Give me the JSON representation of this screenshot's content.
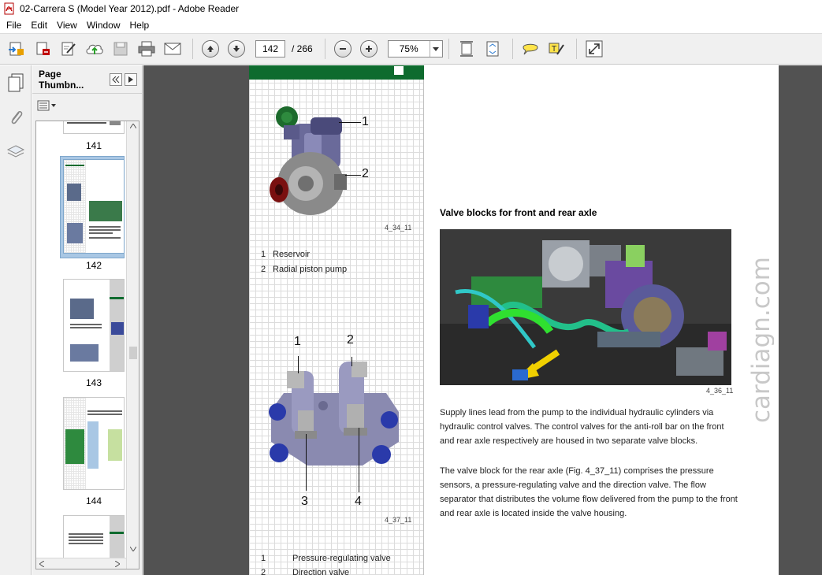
{
  "window": {
    "title": "02-Carrera S (Model Year 2012).pdf - Adobe Reader"
  },
  "menu": [
    "File",
    "Edit",
    "View",
    "Window",
    "Help"
  ],
  "toolbar": {
    "page_current": "142",
    "page_total": "/ 266",
    "zoom": "75%"
  },
  "thumbnails": {
    "header": "Page Thumbn...",
    "pages": [
      {
        "label": "141",
        "selected": false
      },
      {
        "label": "142",
        "selected": true
      },
      {
        "label": "143",
        "selected": false
      },
      {
        "label": "144",
        "selected": false
      }
    ]
  },
  "document": {
    "figure1": {
      "caption": "4_34_11",
      "callouts": [
        "1",
        "2"
      ],
      "legend": [
        {
          "num": "1",
          "text": "Reservoir"
        },
        {
          "num": "2",
          "text": "Radial piston pump"
        }
      ]
    },
    "figure2": {
      "caption": "4_37_11",
      "callouts": [
        "1",
        "2",
        "3",
        "4"
      ],
      "legend": [
        {
          "num": "1",
          "text": "Pressure-regulating valve"
        },
        {
          "num": "2",
          "text": "Direction valve"
        }
      ]
    },
    "section_title": "Valve blocks for front and rear axle",
    "figure3_caption": "4_36_11",
    "paragraph1": "Supply lines lead from the pump to the individual hydraulic cylinders via hydraulic control valves. The control valves for the anti-roll bar on the front and rear axle respectively are housed in two separate valve blocks.",
    "paragraph2": "The valve block for the rear axle (Fig. 4_37_11) comprises the pressure sensors, a pressure-regulating valve and the direction valve. The flow separator that distributes the volume flow delivered from the pump to the front and rear axle is located inside the valve housing.",
    "watermark": "cardiagn.com"
  },
  "colors": {
    "green_band": "#0e6b2e",
    "doc_background": "#525252",
    "selection": "#a9c7e4"
  }
}
